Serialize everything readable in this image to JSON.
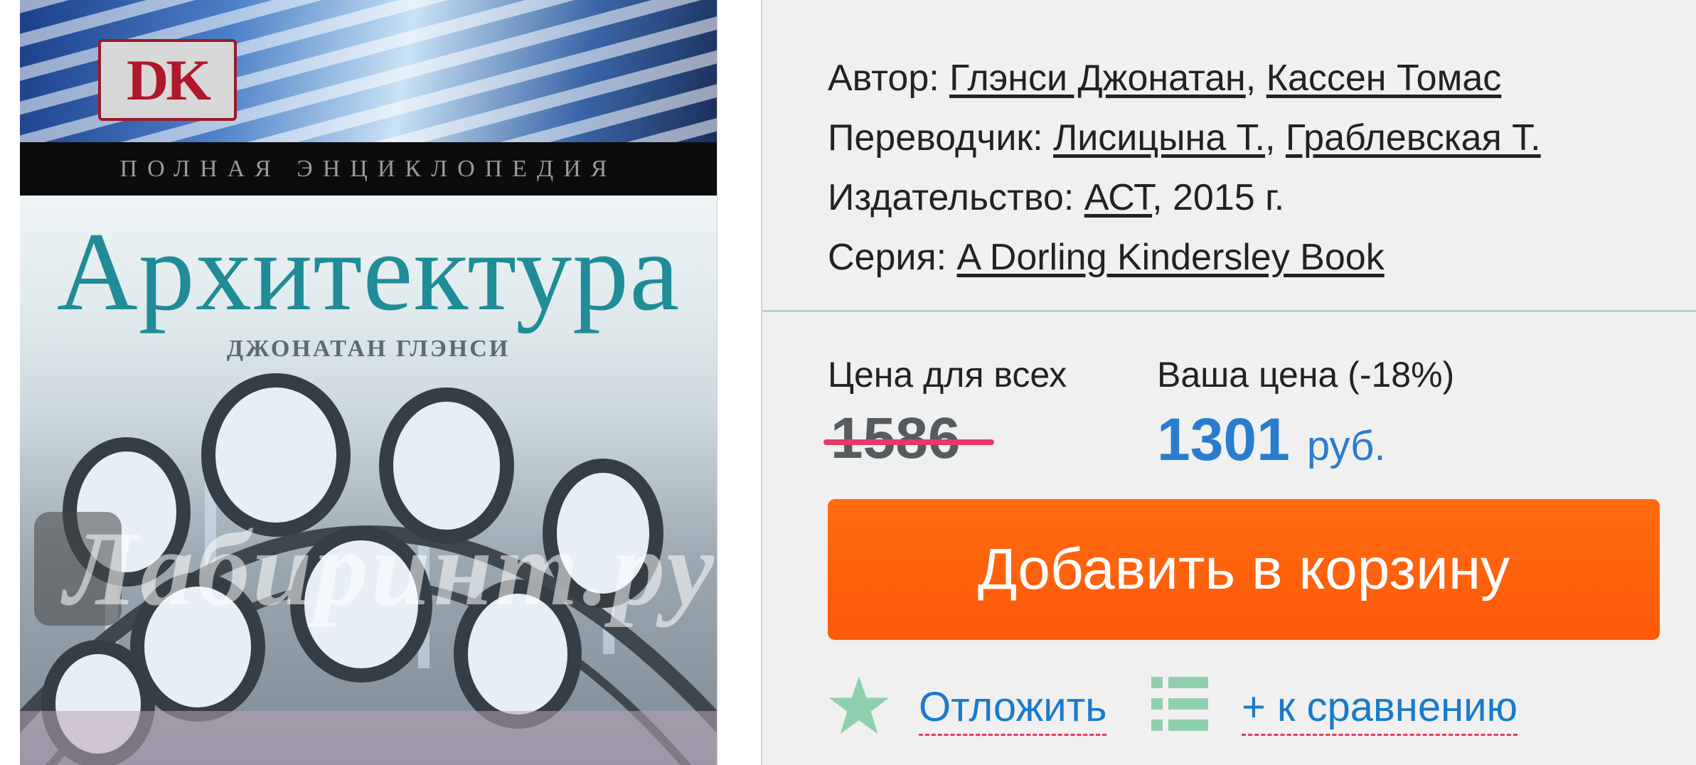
{
  "cover": {
    "publisher_logo": "DK",
    "series_band": "ПОЛНАЯ ЭНЦИКЛОПЕДИЯ",
    "title": "Архитектура",
    "author": "ДЖОНАТАН ГЛЭНСИ",
    "watermark": "Лабиринт.ру"
  },
  "meta": {
    "author_label": "Автор:",
    "authors": [
      "Глэнси Джонатан",
      "Кассен Томас"
    ],
    "translator_label": "Переводчик:",
    "translators": [
      "Лисицына Т.",
      "Граблевская Т."
    ],
    "publisher_label": "Издательство:",
    "publisher": "АСТ",
    "year_text": ", 2015 г.",
    "series_label": "Серия:",
    "series": "A Dorling Kindersley Book"
  },
  "price": {
    "regular_label": "Цена для всех",
    "regular_value": "1586",
    "your_label": "Ваша цена (-18%)",
    "your_value": "1301",
    "currency": "руб."
  },
  "cart_button_label": "Добавить в корзину",
  "actions": {
    "postpone_label": "Отложить",
    "compare_label": "+ к сравнению"
  },
  "colors": {
    "accent_blue": "#2a7ccf",
    "cart_orange": "#fe5a0a",
    "strike_pink": "#e8386a",
    "icon_green": "#8fcfad"
  },
  "icons": [
    "star-icon",
    "list-icon"
  ]
}
